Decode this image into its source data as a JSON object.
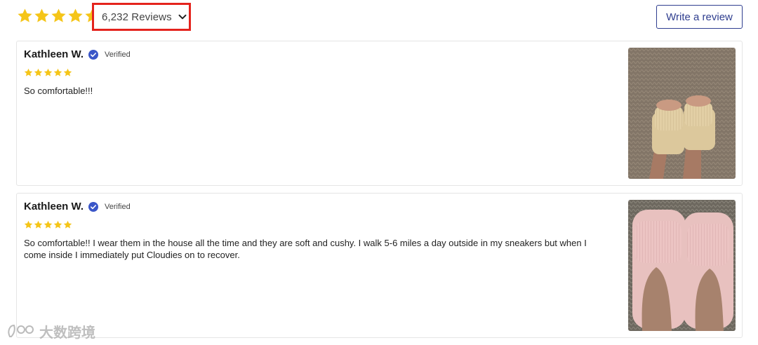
{
  "header": {
    "rating_stars": 5,
    "reviews_toggle_label": "6,232 Reviews",
    "write_review_label": "Write a review"
  },
  "reviews": [
    {
      "name": "Kathleen W.",
      "verified_label": "Verified",
      "rating": 5,
      "body": "So comfortable!!!",
      "photo": "beige slippers on carpet"
    },
    {
      "name": "Kathleen W.",
      "verified_label": "Verified",
      "rating": 5,
      "body": "So comfortable!! I wear them in the house all the time and they are soft and cushy.  I walk 5-6 miles a day outside in my sneakers but when I come inside I immediately put Cloudies on to recover.",
      "photo": "pink slippers on carpet"
    }
  ],
  "watermark": {
    "text": "大数跨境"
  },
  "colors": {
    "star": "#f5c518",
    "accent": "#2f3e8f",
    "highlight_box": "#e4231d",
    "verified": "#3a56c8"
  }
}
